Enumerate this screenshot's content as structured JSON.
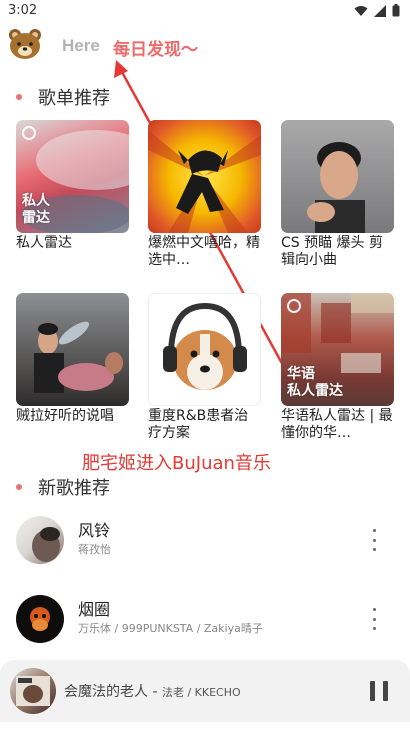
{
  "status_bar": {
    "time": "3:02"
  },
  "header": {
    "title": "Here",
    "tagline": "每日发现～"
  },
  "playlist_section": {
    "title": "歌单推荐",
    "items": [
      {
        "label": "私人雷达",
        "cover_text": "私人\n雷达"
      },
      {
        "label": "爆燃中文嘻哈，精选中…"
      },
      {
        "label": "CS 预瞄 爆头 剪辑向小曲"
      },
      {
        "label": "贼拉好听的说唱"
      },
      {
        "label": "重度R&B患者治疗方案"
      },
      {
        "label": "华语私人雷达 | 最懂你的华…",
        "cover_text": "华语\n私人雷达"
      }
    ]
  },
  "annotation": {
    "text": "肥宅姬进入BuJuan音乐"
  },
  "new_songs_section": {
    "title": "新歌推荐",
    "songs": [
      {
        "title": "风铃",
        "artist": "蒋孜怡"
      },
      {
        "title": "烟圈",
        "artist": "万乐体 / 999PUNKSTA / Zakiya晴子"
      }
    ]
  },
  "player": {
    "title": "会魔法的老人",
    "separator": " - ",
    "artist": "法老 / KKECHO"
  },
  "colors": {
    "accent": "#ef6b6b",
    "annotation": "#e53935",
    "dot": "#e57373"
  }
}
